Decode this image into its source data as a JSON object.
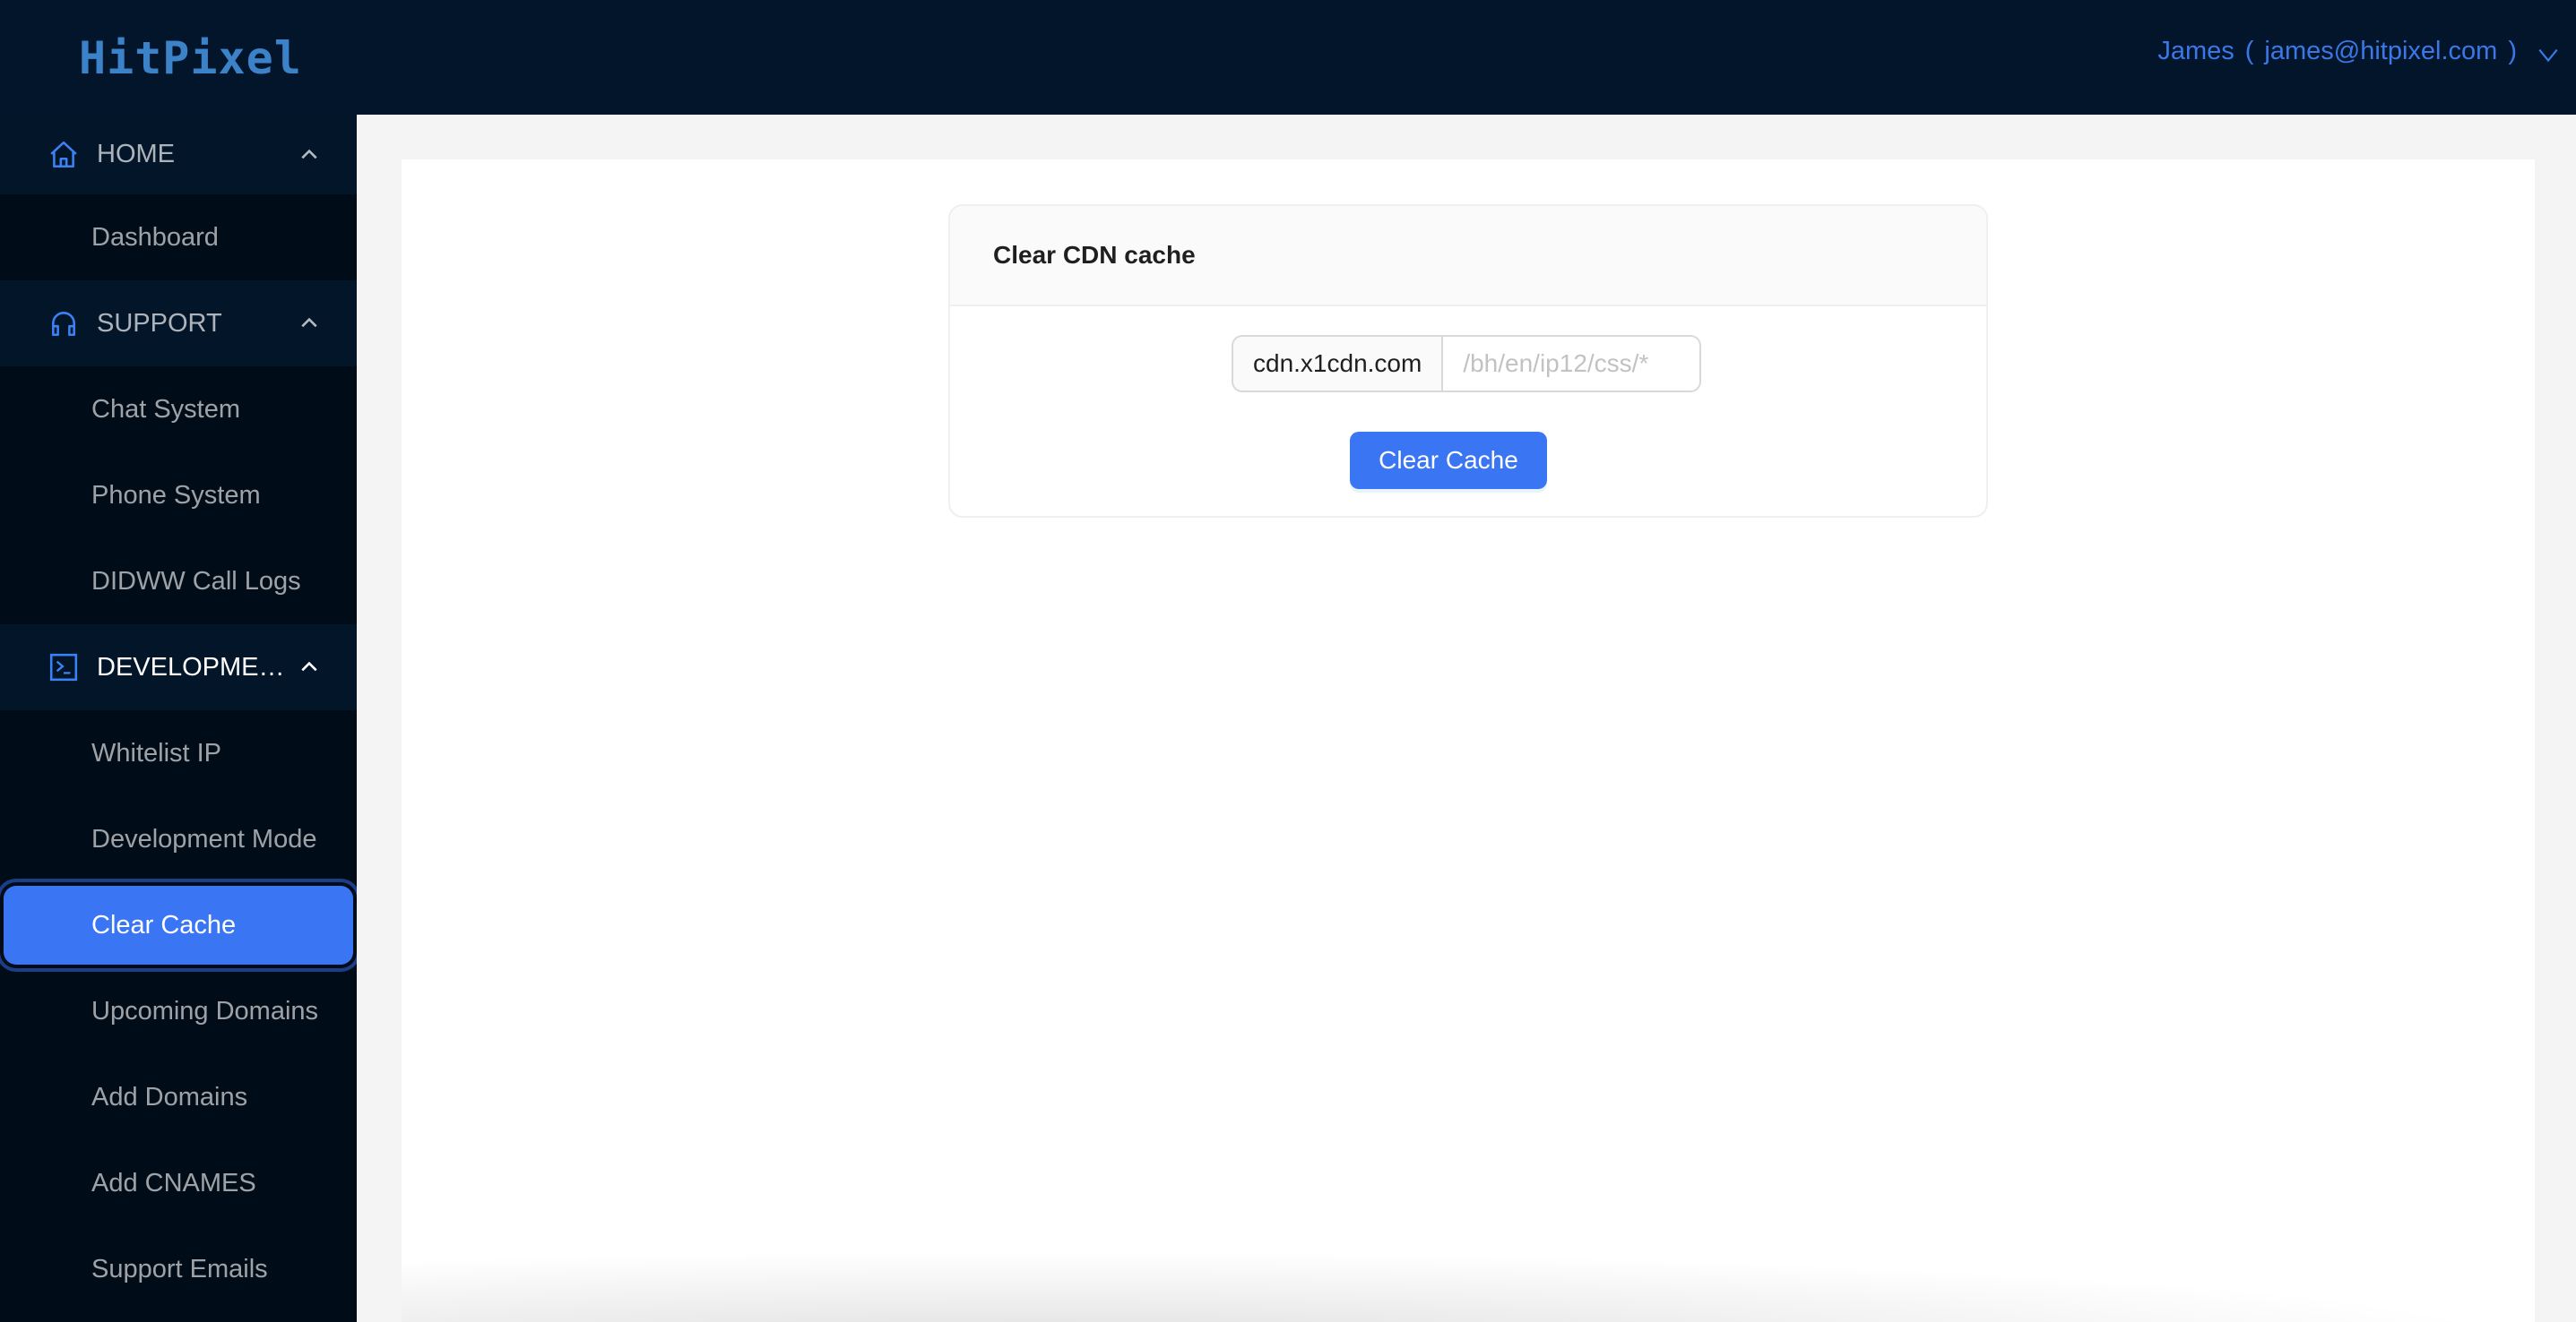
{
  "header": {
    "logo_text": "HitPixel",
    "user_name": "James",
    "user_email": "james@hitpixel.com",
    "open_paren": "(",
    "close_paren": ")"
  },
  "colors": {
    "accent": "#3a76f3",
    "header_bg": "#02152a",
    "sidebar_bg": "#000c17",
    "logo": "#3b82c8"
  },
  "sidebar": {
    "groups": [
      {
        "label": "HOME",
        "icon": "home-icon",
        "expanded": true,
        "items": [
          {
            "label": "Dashboard",
            "active": false
          }
        ]
      },
      {
        "label": "SUPPORT",
        "icon": "headphones-icon",
        "expanded": true,
        "items": [
          {
            "label": "Chat System",
            "active": false
          },
          {
            "label": "Phone System",
            "active": false
          },
          {
            "label": "DIDWW Call Logs",
            "active": false
          }
        ]
      },
      {
        "label": "DEVELOPMEN...",
        "icon": "terminal-icon",
        "expanded": true,
        "items": [
          {
            "label": "Whitelist IP",
            "active": false
          },
          {
            "label": "Development Mode",
            "active": false
          },
          {
            "label": "Clear Cache",
            "active": true
          },
          {
            "label": "Upcoming Domains",
            "active": false
          },
          {
            "label": "Add Domains",
            "active": false
          },
          {
            "label": "Add CNAMES",
            "active": false
          },
          {
            "label": "Support Emails",
            "active": false
          }
        ]
      }
    ]
  },
  "card": {
    "title": "Clear CDN cache",
    "domain_addon": "cdn.x1cdn.com",
    "path_value": "",
    "path_placeholder": "/bh/en/ip12/css/*",
    "submit_label": "Clear Cache"
  }
}
